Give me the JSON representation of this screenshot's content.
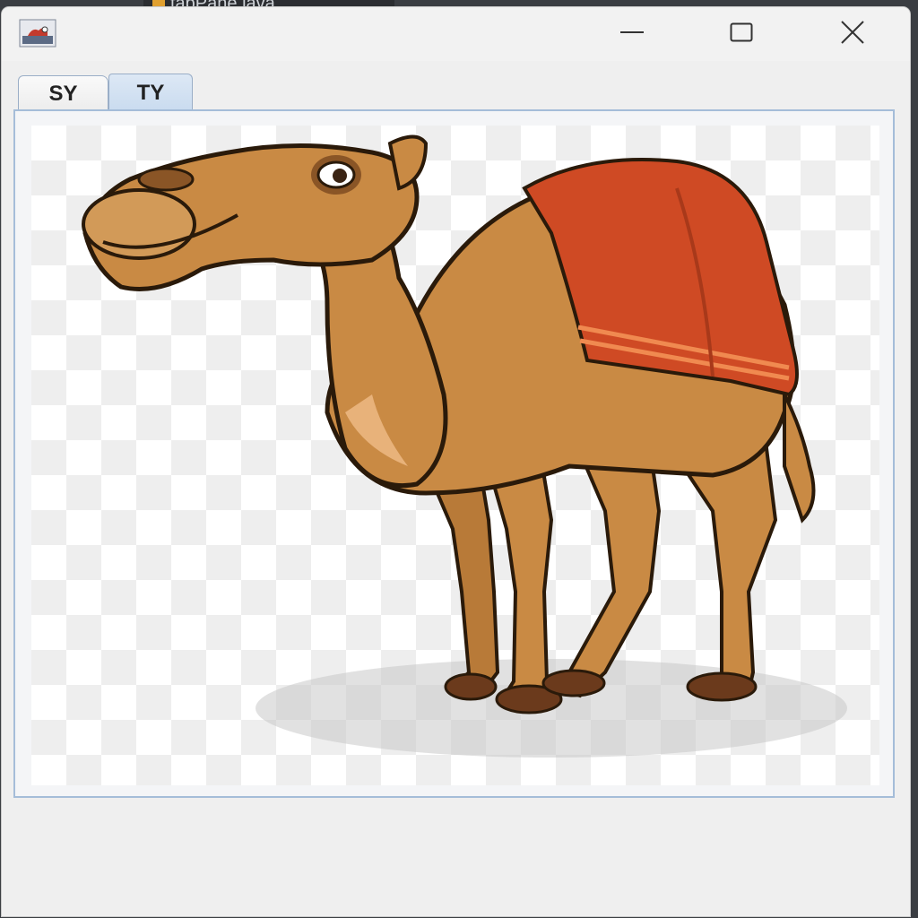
{
  "background_tab": {
    "label": "tabPane.java"
  },
  "window": {
    "icons": {
      "app": "java-app-icon",
      "minimize": "minimize-icon",
      "maximize": "maximize-icon",
      "close": "close-icon"
    }
  },
  "tabs": [
    {
      "label": "SY",
      "selected": false
    },
    {
      "label": "TY",
      "selected": true
    }
  ],
  "content": {
    "image": "camel-illustration"
  },
  "colors": {
    "tab_selected": "#c9dbef",
    "panel_border": "#a5bdd9",
    "camel": "#c98a44",
    "saddle": "#cf4a24"
  }
}
